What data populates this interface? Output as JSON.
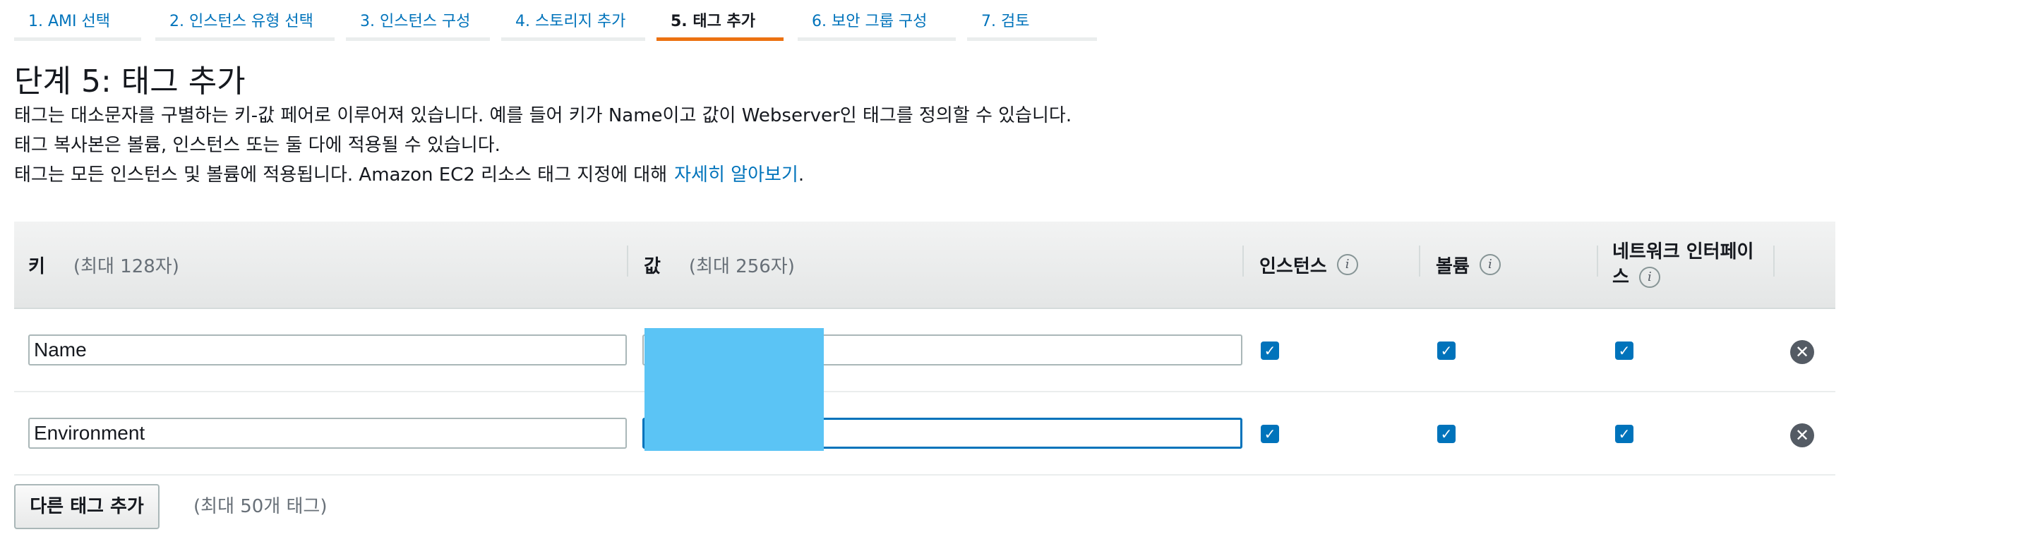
{
  "wizard": {
    "steps": [
      {
        "label": "1. AMI 선택"
      },
      {
        "label": "2. 인스턴스 유형 선택"
      },
      {
        "label": "3. 인스턴스 구성"
      },
      {
        "label": "4. 스토리지 추가"
      },
      {
        "label": "5. 태그 추가",
        "active": true
      },
      {
        "label": "6. 보안 그룹 구성"
      },
      {
        "label": "7. 검토"
      }
    ]
  },
  "page": {
    "title": "단계 5: 태그 추가",
    "desc1": "태그는 대소문자를 구별하는 키-값 페어로 이루어져 있습니다. 예를 들어 키가 Name이고 값이 Webserver인 태그를 정의할 수 있습니다.",
    "desc2": "태그 복사본은 볼륨, 인스턴스 또는 둘 다에 적용될 수 있습니다.",
    "desc3": "태그는 모든 인스턴스 및 볼륨에 적용됩니다. Amazon EC2 리소스 태그 지정에 대해",
    "learn_more": "자세히 알아보기",
    "desc3_end": "."
  },
  "table": {
    "headers": {
      "key": "키",
      "key_hint": "(최대 128자)",
      "value": "값",
      "value_hint": "(최대 256자)",
      "instances": "인스턴스",
      "volumes": "볼륨",
      "network_line1": "네트워크 인터페이",
      "network_line2": "스",
      "info_glyph": "i"
    },
    "rows": [
      {
        "key": "Name",
        "value": "",
        "instances": true,
        "volumes": true,
        "network": true
      },
      {
        "key": "Environment",
        "value": "",
        "instances": true,
        "volumes": true,
        "network": true
      }
    ],
    "check_glyph": "✓",
    "remove_glyph": "✕"
  },
  "footer": {
    "add_button": "다른 태그 추가",
    "add_note": "(최대 50개 태그)"
  },
  "colors": {
    "accent": "#0073bb",
    "active_tab": "#ec7211",
    "redaction": "#5bc4f5"
  }
}
